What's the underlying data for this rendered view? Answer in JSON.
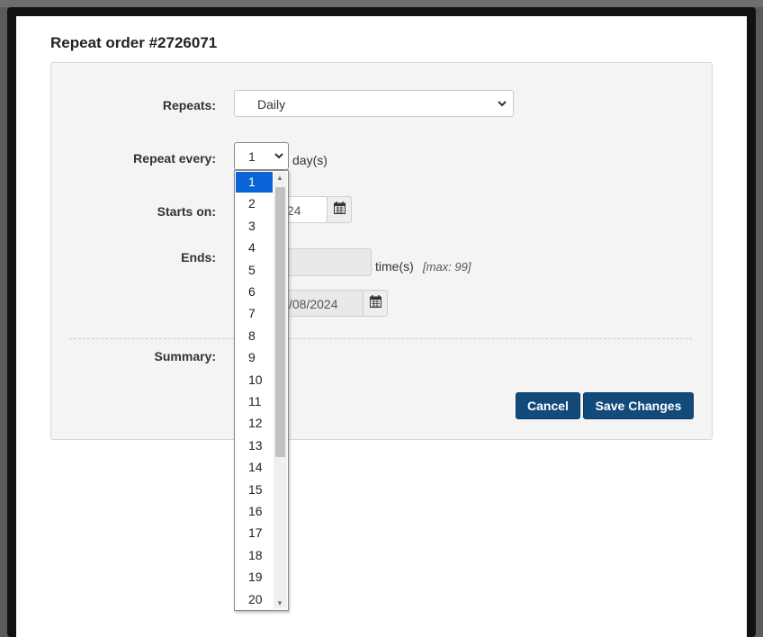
{
  "dialog": {
    "title": "Repeat order #2726071"
  },
  "form": {
    "repeats_label": "Repeats:",
    "repeats_value": "Daily",
    "repeat_every_label": "Repeat every:",
    "repeat_every_value": "1",
    "repeat_every_unit": "day(s)",
    "starts_on_label": "Starts on:",
    "starts_on_value": "24",
    "ends_label": "Ends:",
    "ends_after_unit": "time(s)",
    "ends_after_hint": "[max: 99]",
    "ends_on_value": "/08/2024",
    "summary_label": "Summary:"
  },
  "buttons": {
    "cancel": "Cancel",
    "save": "Save Changes"
  },
  "dropdown": {
    "selected": "1",
    "options": [
      "1",
      "2",
      "3",
      "4",
      "5",
      "6",
      "7",
      "8",
      "9",
      "10",
      "11",
      "12",
      "13",
      "14",
      "15",
      "16",
      "17",
      "18",
      "19",
      "20"
    ]
  },
  "colors": {
    "primary_button": "#134a7c",
    "selected_option": "#0a64d8"
  },
  "icons": {
    "calendar": "calendar-icon",
    "chevron": "chevron-down-icon"
  }
}
